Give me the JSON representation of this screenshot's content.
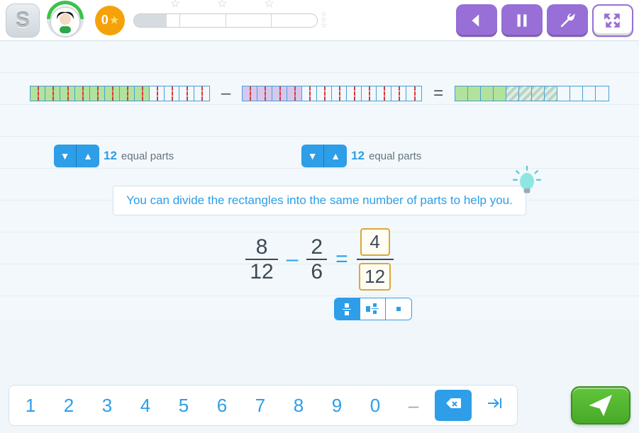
{
  "header": {
    "logo_letter": "S",
    "score": "0",
    "progress_segments": 4,
    "buttons": {
      "back": "back-icon",
      "pause": "pause-icon",
      "tools": "wrench-icon",
      "fullscreen": "fullscreen-icon"
    }
  },
  "bars": {
    "bar1": {
      "total_cells": 12,
      "filled": 8,
      "fill_color": "green",
      "show_half_dash": true
    },
    "bar2": {
      "total_cells": 12,
      "filled": 4,
      "fill_color": "purple",
      "show_half_dash": true
    },
    "bar3": {
      "total_cells": 12,
      "green": 4,
      "hatch": 4
    },
    "op_minus": "–",
    "op_equals": "="
  },
  "steppers": [
    {
      "value": "12",
      "label": "equal parts"
    },
    {
      "value": "12",
      "label": "equal parts"
    }
  ],
  "hint": {
    "text": "You can divide the rectangles into the same number of parts to help you."
  },
  "equation": {
    "left": {
      "num": "8",
      "den": "12"
    },
    "op1": "–",
    "right": {
      "num": "2",
      "den": "6"
    },
    "op2": "=",
    "answer": {
      "num": "4",
      "den": "12"
    }
  },
  "modes": [
    "fraction",
    "mixed",
    "whole"
  ],
  "keypad": {
    "digits": [
      "1",
      "2",
      "3",
      "4",
      "5",
      "6",
      "7",
      "8",
      "9",
      "0"
    ],
    "minus": "–",
    "backspace": "backspace-icon",
    "tab": "tab-icon"
  }
}
